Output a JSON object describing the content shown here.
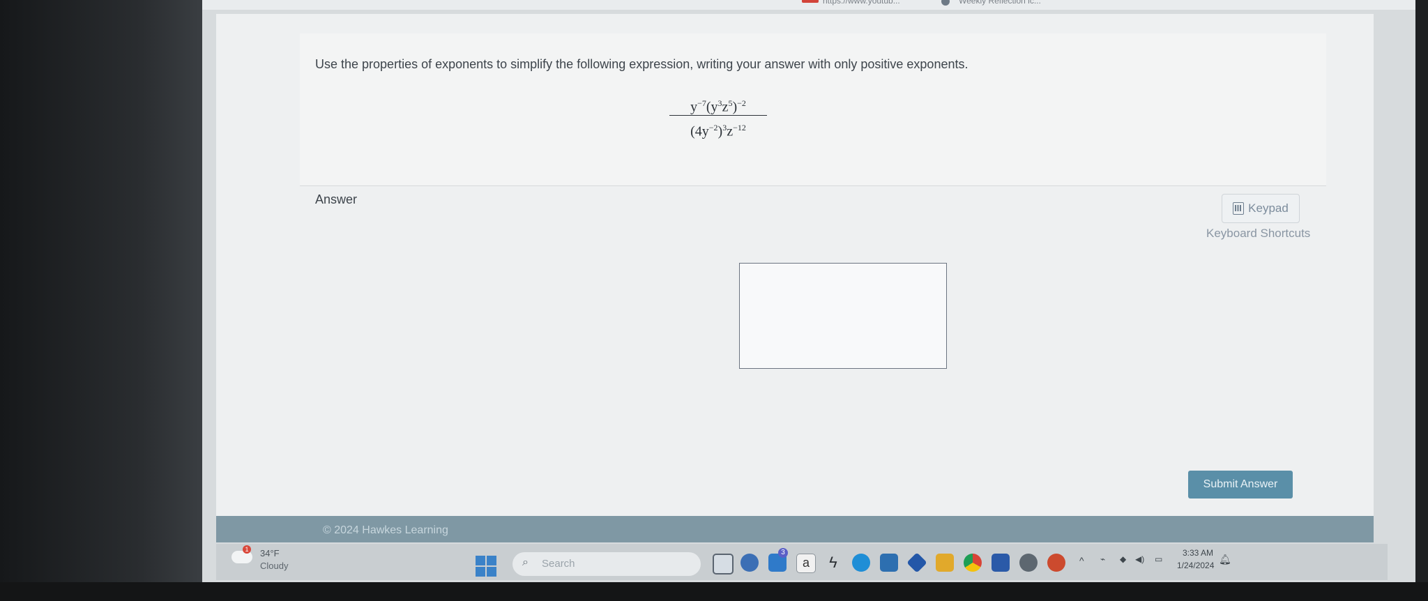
{
  "browser": {
    "tab_url": "https://www.youtub...",
    "tab_title": "Weekly Reflection ic..."
  },
  "question": {
    "prompt": "Use the properties of exponents to simplify the following expression, writing your answer with only positive exponents.",
    "numerator_base1": "y",
    "numerator_exp1": "−7",
    "numerator_inner": "y",
    "numerator_inner_exp1": "3",
    "numerator_inner_var2": "z",
    "numerator_inner_exp2": "5",
    "numerator_outer_exp": "−2",
    "denominator_coef": "4y",
    "denominator_inner_exp": "−2",
    "denominator_outer_exp": "3",
    "denominator_var": "z",
    "denominator_var_exp": "−12"
  },
  "answer": {
    "label": "Answer",
    "keypad_label": "Keypad",
    "shortcuts_label": "Keyboard Shortcuts",
    "input_value": "",
    "submit_label": "Submit Answer"
  },
  "footer": {
    "copyright": "© 2024 Hawkes Learning"
  },
  "taskbar": {
    "weather_badge": "1",
    "temperature": "34°F",
    "condition": "Cloudy",
    "search_placeholder": "Search",
    "teams_badge": "3",
    "time": "3:33 AM",
    "date": "1/24/2024",
    "apps": [
      "file-explorer-icon",
      "meet-icon",
      "photos-icon",
      "amazon-icon",
      "winamp-icon",
      "edge-icon",
      "store-icon",
      "copilot-icon",
      "folder-icon",
      "chrome-icon",
      "word-icon",
      "settings-icon",
      "powerpoint-icon"
    ]
  }
}
